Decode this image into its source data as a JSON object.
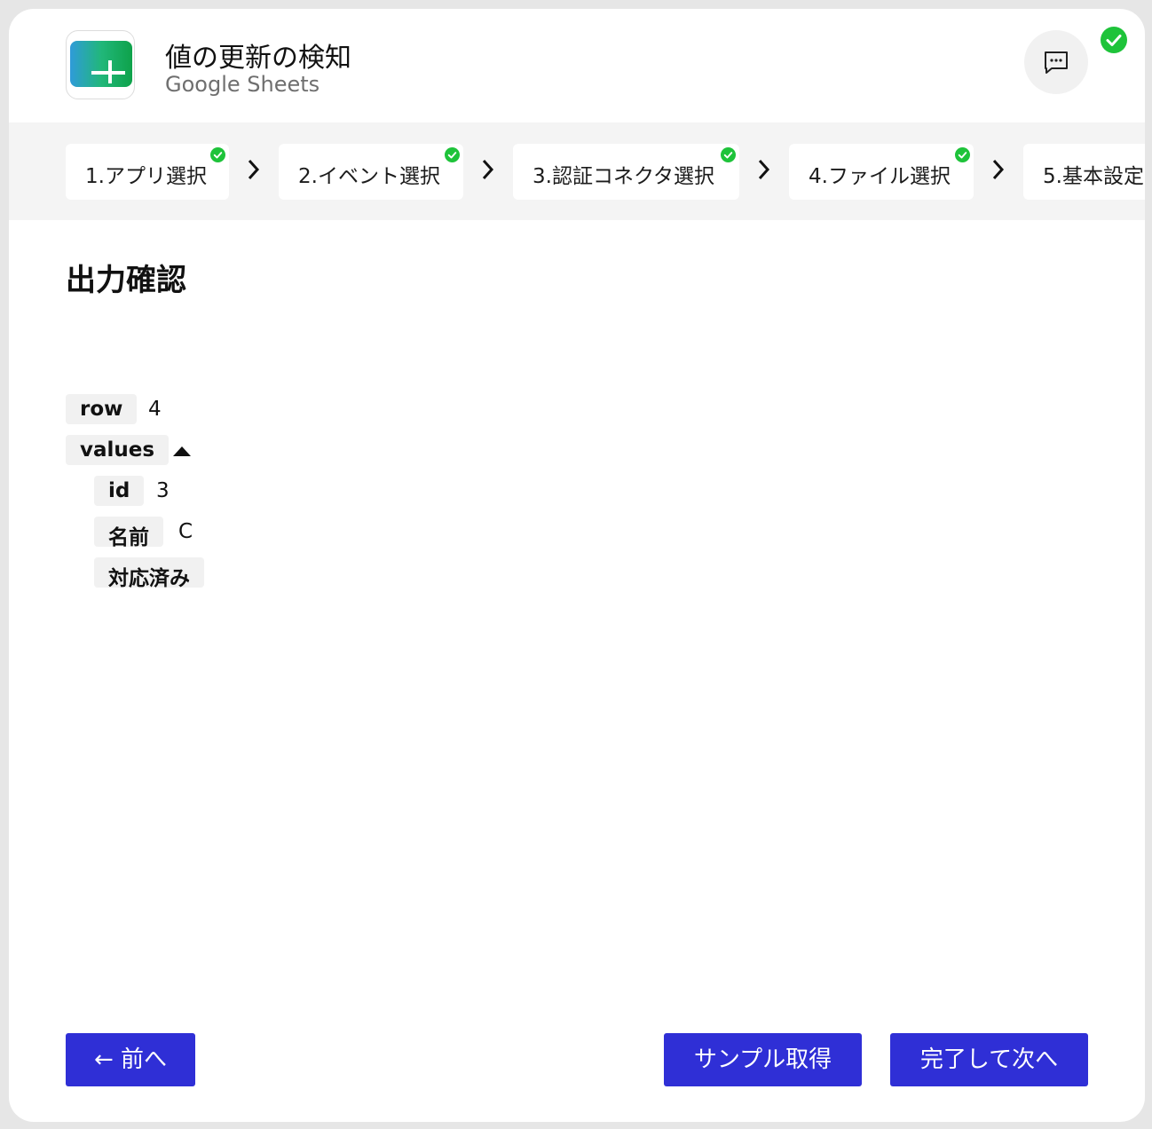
{
  "header": {
    "title": "値の更新の検知",
    "subtitle": "Google Sheets",
    "logo_icon": "google-sheets-logo",
    "chat_icon": "chat-bubble-icon",
    "status_icon": "check-circle-icon"
  },
  "steps": [
    {
      "label": "1.アプリ選択",
      "completed": true
    },
    {
      "label": "2.イベント選択",
      "completed": true
    },
    {
      "label": "3.認証コネクタ選択",
      "completed": true
    },
    {
      "label": "4.ファイル選択",
      "completed": true
    },
    {
      "label": "5.基本設定",
      "completed": false
    }
  ],
  "main": {
    "section_title": "出力確認",
    "output": {
      "row": {
        "key": "row",
        "value": "4"
      },
      "values": {
        "key": "values",
        "expanded": true,
        "items": [
          {
            "key": "id",
            "value": "3"
          },
          {
            "key": "名前",
            "value": "C"
          },
          {
            "key": "対応済み",
            "value": ""
          }
        ]
      }
    }
  },
  "footer": {
    "prev_label": "← 前へ",
    "sample_label": "サンプル取得",
    "next_label": "完了して次へ"
  },
  "colors": {
    "primary_button": "#2f2fd6",
    "success": "#1ec33a",
    "stepper_bg": "#f4f4f4",
    "key_bg": "#f1f1f1"
  }
}
